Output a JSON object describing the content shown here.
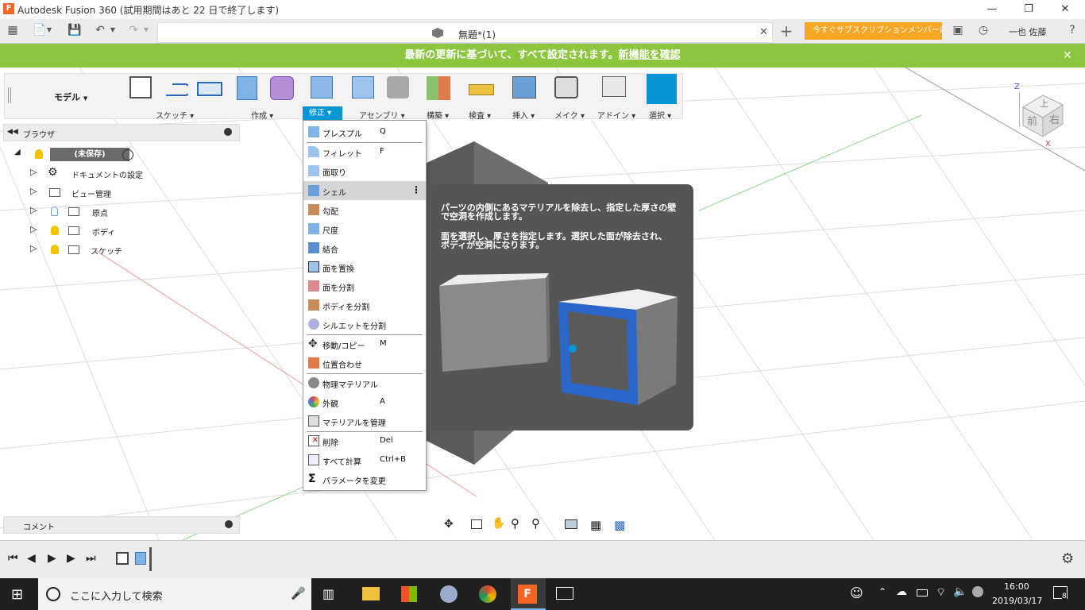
{
  "window": {
    "title": "Autodesk Fusion 360 (試用期間はあと 22 日で終了します)",
    "controls": [
      "minimize-icon",
      "restore-icon",
      "close-icon"
    ]
  },
  "appbar": {
    "doc_tab_title": "無題*(1)",
    "trial_button": "今すぐサブスクリプションメンバーに...",
    "user_name": "一也 佐藤",
    "icons": [
      "grid-icon",
      "file-icon",
      "save-icon",
      "undo-icon",
      "redo-icon",
      "plus-icon",
      "comment-icon",
      "clock-icon",
      "help-icon"
    ]
  },
  "banner": {
    "text": "最新の更新に基づいて、すべて設定されます。",
    "link": "新機能を確認",
    "close": "✕"
  },
  "ribbon": {
    "workspace": "モデル",
    "groups": [
      {
        "label": "スケッチ ▾"
      },
      {
        "label": "作成 ▾"
      },
      {
        "label": "修正 ▾"
      },
      {
        "label": "アセンブリ ▾"
      },
      {
        "label": "構築 ▾"
      },
      {
        "label": "検査 ▾"
      },
      {
        "label": "挿入 ▾"
      },
      {
        "label": "メイク ▾"
      },
      {
        "label": "アドイン ▾"
      },
      {
        "label": "選択 ▾"
      }
    ]
  },
  "browser": {
    "title": "ブラウザ",
    "root": "(未保存)",
    "items": [
      {
        "label": "ドキュメントの設定"
      },
      {
        "label": "ビュー管理"
      },
      {
        "label": "原点"
      },
      {
        "label": "ボディ"
      },
      {
        "label": "スケッチ"
      }
    ]
  },
  "menu": {
    "items": [
      {
        "label": "プレスプル",
        "shortcut": "Q"
      },
      {
        "label": "フィレット",
        "shortcut": "F"
      },
      {
        "label": "面取り",
        "shortcut": ""
      },
      {
        "label": "シェル",
        "shortcut": ""
      },
      {
        "label": "勾配",
        "shortcut": ""
      },
      {
        "label": "尺度",
        "shortcut": ""
      },
      {
        "label": "結合",
        "shortcut": ""
      },
      {
        "label": "面を置換",
        "shortcut": ""
      },
      {
        "label": "面を分割",
        "shortcut": ""
      },
      {
        "label": "ボディを分割",
        "shortcut": ""
      },
      {
        "label": "シルエットを分割",
        "shortcut": ""
      },
      {
        "label": "移動/コピー",
        "shortcut": "M"
      },
      {
        "label": "位置合わせ",
        "shortcut": ""
      },
      {
        "label": "物理マテリアル",
        "shortcut": ""
      },
      {
        "label": "外観",
        "shortcut": "A"
      },
      {
        "label": "マテリアルを管理",
        "shortcut": ""
      },
      {
        "label": "削除",
        "shortcut": "Del"
      },
      {
        "label": "すべて計算",
        "shortcut": "Ctrl+B"
      },
      {
        "label": "パラメータを変更",
        "shortcut": ""
      }
    ]
  },
  "tooltip": {
    "line1a": "パーツの内側にあるマテリアルを除去し、指定した厚さの壁",
    "line1b": "で空洞を作成します。",
    "line2a": "面を選択し、厚さを指定します。選択した面が除去され、",
    "line2b": "ボディが空洞になります。"
  },
  "viewcube": {
    "top": "上",
    "front": "前",
    "right": "右",
    "axis_z": "Z",
    "axis_x": "X"
  },
  "comment": {
    "title": "コメント"
  },
  "taskbar": {
    "search_placeholder": "ここに入力して検索",
    "time": "16:00",
    "date": "2019/03/17",
    "notification_count": "8"
  },
  "colors": {
    "banner": "#8cc63f",
    "trial": "#f5a623",
    "accent": "#0696d7",
    "selection_blue": "#2a67c9"
  }
}
